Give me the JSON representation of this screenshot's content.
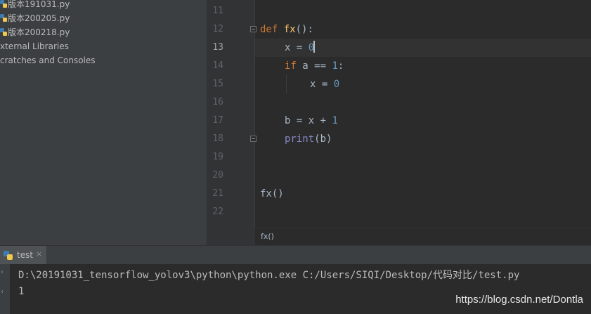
{
  "project_tree": {
    "items": [
      {
        "label": "版本191031.py",
        "icon": "python-file-icon"
      },
      {
        "label": "版本200205.py",
        "icon": "python-file-icon"
      },
      {
        "label": "版本200218.py",
        "icon": "python-file-icon"
      },
      {
        "label": "xternal Libraries",
        "icon": ""
      },
      {
        "label": "cratches and Consoles",
        "icon": ""
      }
    ]
  },
  "editor": {
    "line_numbers": [
      "11",
      "12",
      "13",
      "14",
      "15",
      "16",
      "17",
      "18",
      "19",
      "20",
      "21",
      "22"
    ],
    "current_line": "13",
    "code": {
      "l12_kw": "def",
      "l12_fn": "fx",
      "l12_rest": "():",
      "l13_a": "x = ",
      "l13_num": "0",
      "l14_kw": "if",
      "l14_mid": " a == ",
      "l14_num": "1",
      "l14_end": ":",
      "l15_a": "x = ",
      "l15_num": "0",
      "l17_a": "b = x + ",
      "l17_num": "1",
      "l18_bi": "print",
      "l18_rest": "(b)",
      "l21": "fx()"
    },
    "breadcrumb": "fx()"
  },
  "run_window": {
    "tab_label": "test",
    "tab_close": "×",
    "output_lines": [
      "D:\\20191031_tensorflow_yolov3\\python\\python.exe C:/Users/SIQI/Desktop/代码对比/test.py",
      "1"
    ]
  },
  "watermark": "https://blog.csdn.net/Dontla",
  "colors": {
    "keyword": "#cc7832",
    "function": "#ffc66d",
    "number": "#6897bb",
    "builtin": "#8888c6",
    "text": "#a9b7c6"
  }
}
